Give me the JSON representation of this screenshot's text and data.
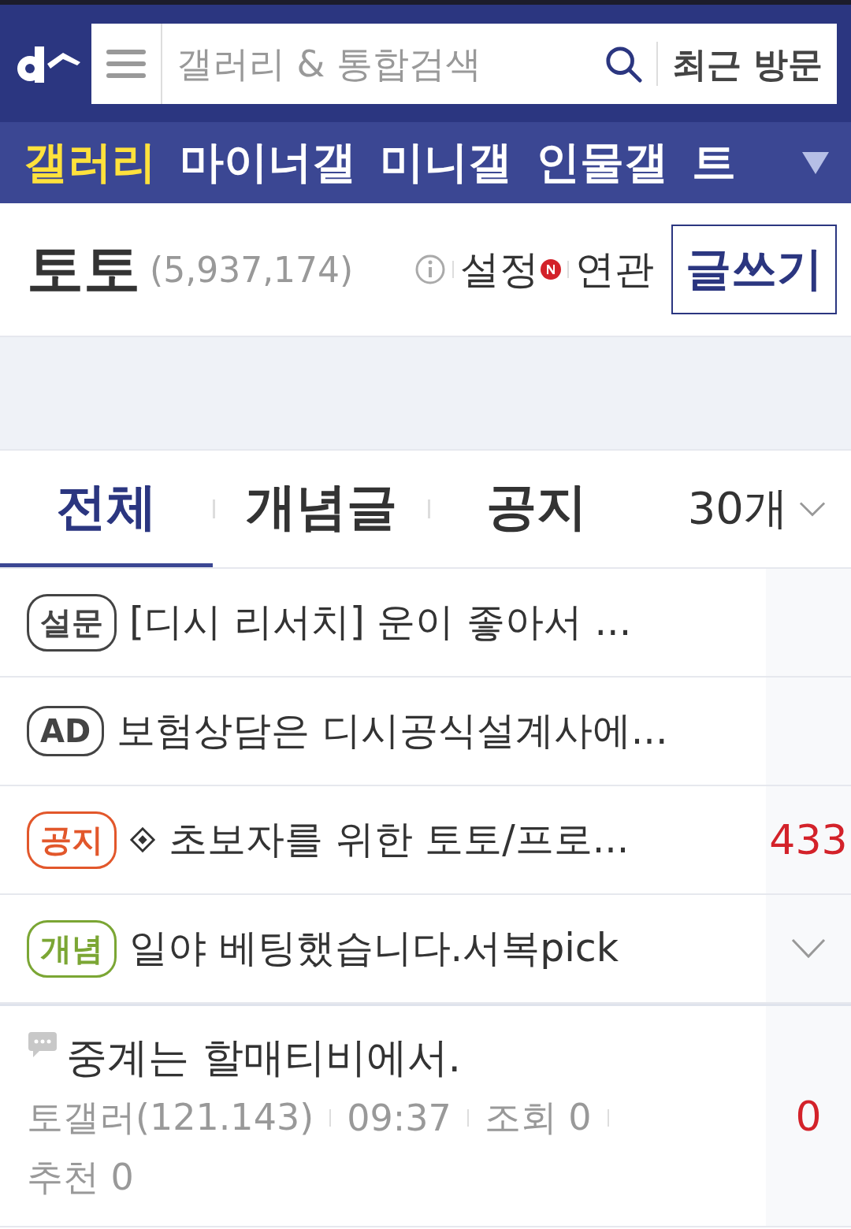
{
  "header": {
    "search": {
      "placeholder": "갤러리 & 통합검색"
    },
    "recent_button": "최근 방문"
  },
  "nav": [
    {
      "label": "갤러리",
      "selected": true
    },
    {
      "label": "마이너갤",
      "selected": false
    },
    {
      "label": "미니갤",
      "selected": false
    },
    {
      "label": "인물갤",
      "selected": false
    },
    {
      "label": "트",
      "selected": false
    }
  ],
  "gallery": {
    "name": "토토",
    "count": "(5,937,174)",
    "settings": "설정",
    "settings_new": true,
    "related": "연관",
    "write_button": "글쓰기"
  },
  "tabs": [
    {
      "label": "전체",
      "selected": true
    },
    {
      "label": "개념글",
      "selected": false
    },
    {
      "label": "공지",
      "selected": false
    }
  ],
  "page_size": "30개",
  "posts": [
    {
      "kind": "badge",
      "badge": {
        "text": "설문",
        "color": "#444444"
      },
      "marker": false,
      "title": "[디시 리서치] 운이 좋아서 ...",
      "toggle": false
    },
    {
      "kind": "badge",
      "badge": {
        "text": "AD",
        "color": "#444444"
      },
      "marker": false,
      "title": "보험상담은 디시공식설계사에...",
      "toggle": false
    },
    {
      "kind": "badge",
      "badge": {
        "text": "공지",
        "color": "#e2572b"
      },
      "marker": true,
      "title": "초보자를 위한 토토/프로...",
      "count": "433",
      "toggle": false
    },
    {
      "kind": "badge",
      "badge": {
        "text": "개념",
        "color": "#7ba634"
      },
      "marker": false,
      "title": "일야 베팅했습니다.서복pick",
      "toggle": true
    },
    {
      "kind": "detail",
      "title": "중계는 할매티비에서.",
      "author": "토갤러(121.143)",
      "time": "09:37",
      "views": "조회 0",
      "likes": "추천 0",
      "count": "0"
    }
  ]
}
